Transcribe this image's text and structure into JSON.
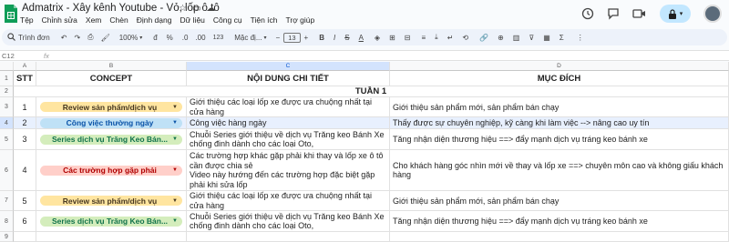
{
  "app": {
    "doc_title": "Admatrix - Xây kênh Youtube - Vỏ, lốp ô tô",
    "menu": [
      "Tệp",
      "Chỉnh sửa",
      "Xem",
      "Chèn",
      "Định dạng",
      "Dữ liệu",
      "Công cụ",
      "Tiện ích",
      "Trợ giúp"
    ]
  },
  "toolbar": {
    "search": "Trình đơn",
    "zoom": "100%",
    "currency": "đ",
    "percent": "%",
    "dec_down": ".0",
    "dec_up": ".00",
    "more_formats": "123",
    "font": "Mặc đị...",
    "font_size": "13",
    "bold": "B",
    "italic": "I",
    "strike": "S",
    "text_color": "A"
  },
  "formula_bar": {
    "cell_ref": "C12",
    "fx": "fx"
  },
  "columns": [
    "A",
    "B",
    "C",
    "D"
  ],
  "headers": {
    "stt": "STT",
    "concept": "CONCEPT",
    "detail": "NỘI DUNG CHI TIẾT",
    "purpose": "MỤC ĐÍCH"
  },
  "week_label": "TUẦN 1",
  "row_numbers": [
    "1",
    "2",
    "3",
    "4",
    "5",
    "6",
    "7",
    "8",
    "9"
  ],
  "rows": [
    {
      "stt": "1",
      "concept": "Review sản phẩm/dịch vụ",
      "concept_color": "#ffe5a0",
      "detail": "Giới thiệu các loại lốp xe được ưa chuộng nhất tại cửa hàng",
      "purpose": "Giới thiệu sản phẩm mới, sản phẩm bán chạy"
    },
    {
      "stt": "2",
      "concept": "Công việc thường ngày",
      "concept_color": "#bfe1f6",
      "detail": "Công việc hàng ngày",
      "purpose": "Thấy được sự chuyên nghiệp, kỹ càng khi làm việc --> nâng cao uy tín"
    },
    {
      "stt": "3",
      "concept": "Series dịch vụ Trăng Keo Bán...",
      "concept_color": "#d4edbc",
      "detail": "Chuỗi Series giới thiệu về dịch vụ Trăng keo Bánh Xe chống đinh dành cho các loại Oto,",
      "purpose": "Tăng nhận diện thương hiệu ==> đẩy mạnh dịch vụ tráng keo bánh xe"
    },
    {
      "stt": "4",
      "concept": "Các trường hợp gặp phải",
      "concept_color": "#ffcfc9",
      "detail": "Các trường hợp khác gặp phải khi thay và lốp xe ô tô cần được chia sẻ\nVideo này hướng đến các trường hợp đặc biệt gặp phải khi sửa lốp",
      "purpose": "Cho khách hàng góc nhìn mới về thay và lốp xe ==> chuyên môn cao và không giấu khách hàng"
    },
    {
      "stt": "5",
      "concept": "Review sản phẩm/dịch vụ",
      "concept_color": "#ffe5a0",
      "detail": "Giới thiệu các loại lốp xe được ưa chuộng nhất tại cửa hàng",
      "purpose": "Giới thiệu sản phẩm mới, sản phẩm bán chạy"
    },
    {
      "stt": "6",
      "concept": "Series dịch vụ Trăng Keo Bán...",
      "concept_color": "#d4edbc",
      "detail": "Chuỗi Series giới thiệu về dịch vụ Trăng keo Bánh Xe chống đinh dành cho các loại Oto,",
      "purpose": "Tăng nhận diện thương hiệu ==> đẩy mạnh dịch vụ tráng keo bánh xe"
    }
  ],
  "last_row_stt": "",
  "icons": [
    "sheets-logo-icon",
    "star-icon",
    "folder-icon",
    "cloud-icon",
    "history-icon",
    "comment-icon",
    "video-icon",
    "lock-icon",
    "chevron-down-icon",
    "search-icon",
    "undo-icon",
    "redo-icon",
    "print-icon",
    "paint-format-icon",
    "dropdown-arrow-icon"
  ]
}
